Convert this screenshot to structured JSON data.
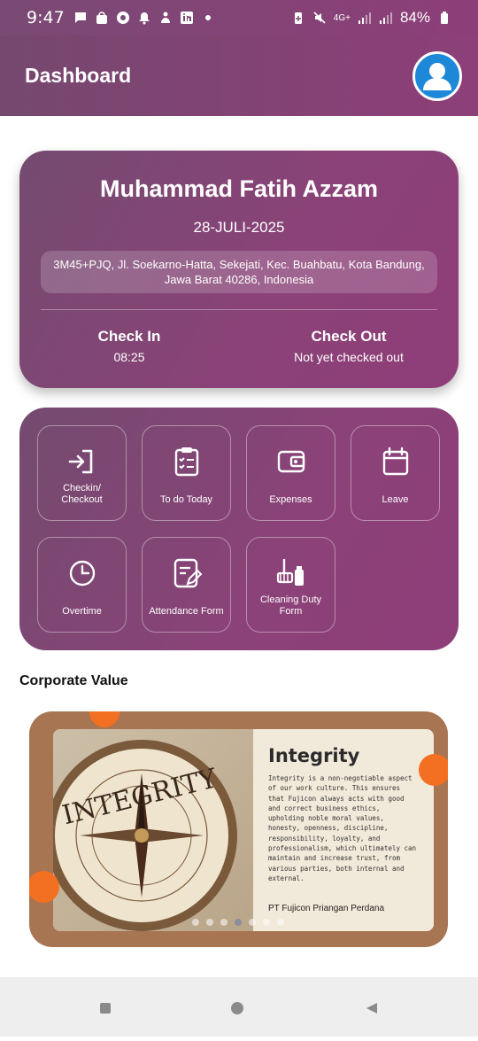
{
  "status_bar": {
    "time": "9:47",
    "network": "4G+",
    "battery": "84%"
  },
  "header": {
    "title": "Dashboard"
  },
  "profile": {
    "name": "Muhammad Fatih Azzam",
    "date": "28-JULI-2025",
    "address": "3M45+PJQ, Jl. Soekarno-Hatta, Sekejati, Kec. Buahbatu, Kota Bandung, Jawa Barat 40286, Indonesia",
    "check_in_label": "Check In",
    "check_in_value": "08:25",
    "check_out_label": "Check Out",
    "check_out_value": "Not yet checked out"
  },
  "menu": [
    {
      "label": "Checkin/ Checkout",
      "icon": "login-icon"
    },
    {
      "label": "To do Today",
      "icon": "clipboard-check-icon"
    },
    {
      "label": "Expenses",
      "icon": "wallet-icon"
    },
    {
      "label": "Leave",
      "icon": "calendar-icon"
    },
    {
      "label": "Overtime",
      "icon": "clock-icon"
    },
    {
      "label": "Attendance Form",
      "icon": "form-edit-icon"
    },
    {
      "label": "Cleaning Duty Form",
      "icon": "cleaning-icon"
    }
  ],
  "corporate": {
    "section_title": "Corporate Value",
    "value_title": "Integrity",
    "value_text": "Integrity is a non-negotiable aspect of our work culture. This ensures that Fujicon always acts with good and correct business ethics, upholding noble moral values, honesty, openness, discipline, responsibility, loyalty, and professionalism, which ultimately can maintain and increase trust, from various parties, both internal and external.",
    "company": "PT Fujicon Priangan Perdana",
    "compass_word": "INTEGRITY",
    "slides_total": 7,
    "active_slide": 4
  },
  "colors": {
    "primary_start": "#744b70",
    "primary_end": "#8f3d78",
    "banner_frame": "#a77552",
    "accent_orange": "#f36f21",
    "avatar_blue": "#1e88d8"
  }
}
